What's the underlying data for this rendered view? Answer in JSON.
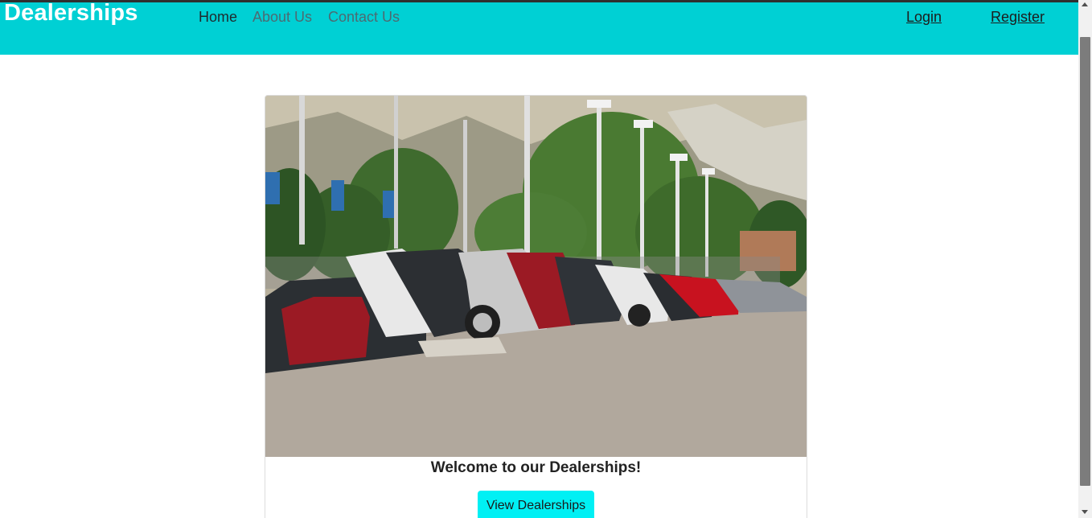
{
  "navbar": {
    "brand": "Dealerships",
    "links": [
      {
        "label": "Home"
      },
      {
        "label": "About Us"
      },
      {
        "label": "Contact Us"
      }
    ],
    "login_label": "Login",
    "register_label": "Register"
  },
  "hero": {
    "image_icon": "car-lot-photo",
    "welcome_text": "Welcome to our Dealerships!",
    "button_label": "View Dealerships"
  },
  "colors": {
    "navbar_bg": "#00d0d4",
    "button_bg": "#00f0f4"
  }
}
